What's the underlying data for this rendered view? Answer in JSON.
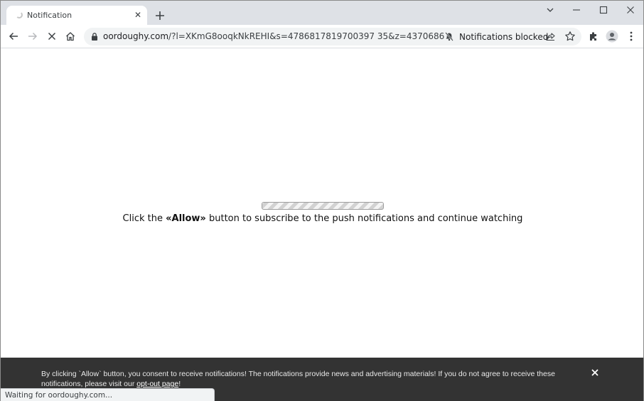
{
  "browser": {
    "tab": {
      "title": "Notification",
      "close_glyph": "✕"
    },
    "window_controls": [
      "chevron-down-icon",
      "minimize-icon",
      "maximize-icon",
      "close-icon"
    ],
    "url": {
      "domain": "oordoughy.com",
      "rest": "/?l=XKmG8ooqkNkREHI&s=4786817819700397 35&z=4370686"
    },
    "notifications_blocked": "Notifications blocked"
  },
  "page": {
    "headline_before": "Click the ",
    "headline_bold": "«Allow»",
    "headline_after": " button to subscribe to the push notifications and continue watching"
  },
  "consent": {
    "text": "By clicking `Allow` button, you consent to receive notifications! The notifications provide news and advertising materials! If you do not agree to receive these notifications, please visit our ",
    "link": "opt-out page",
    "after_link": "!"
  },
  "status": {
    "text": "Waiting for oordoughy.com..."
  },
  "colors": {
    "tabstrip": "#dee1e6",
    "omnibox": "#f1f3f4",
    "consent_bar": "#333333"
  }
}
